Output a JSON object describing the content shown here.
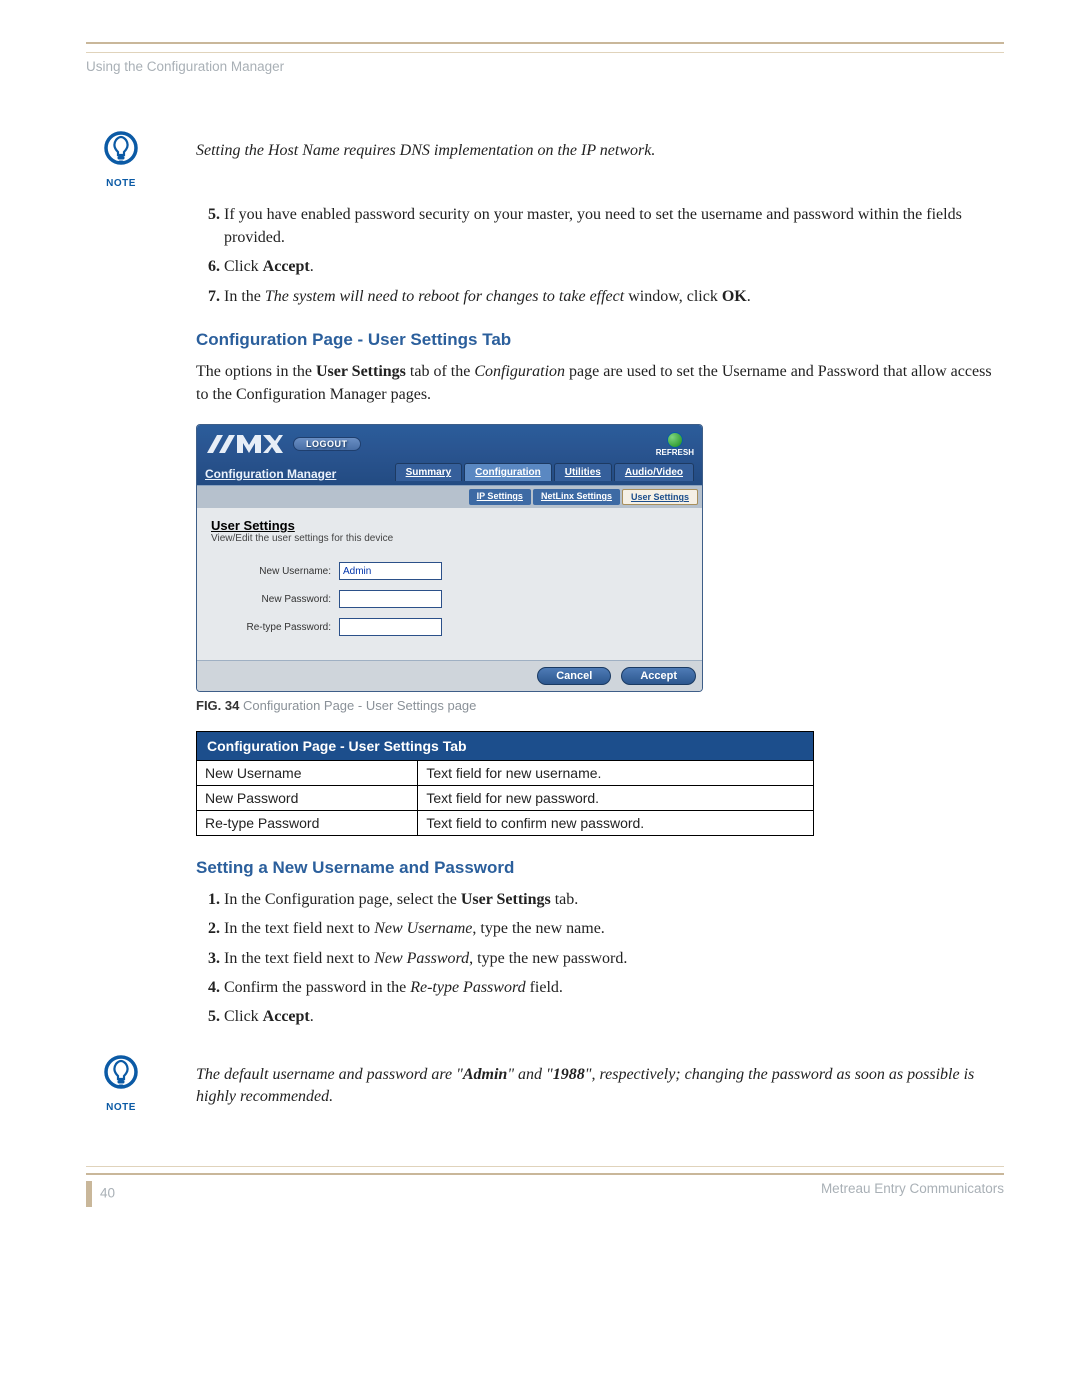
{
  "header": {
    "section": "Using the Configuration Manager"
  },
  "note1": {
    "label": "NOTE",
    "text": "Setting the Host Name requires DNS implementation on the IP network."
  },
  "steps_a": {
    "5": "If you have enabled password security on your master, you need to set the username and password within the fields provided.",
    "6_pre": "Click ",
    "6_bold": "Accept",
    "6_post": ".",
    "7_pre": "In the ",
    "7_it": "The system will need to reboot for changes to take effect",
    "7_mid": " window, click ",
    "7_bold": "OK",
    "7_post": "."
  },
  "h2a": "Configuration Page - User Settings Tab",
  "para1_pre": "The options in the ",
  "para1_b1": "User Settings",
  "para1_mid": " tab of the ",
  "para1_it": "Configuration",
  "para1_after": " page are used to set the Username and Password that allow access to the Configuration Manager pages.",
  "screenshot": {
    "logout": "LOGOUT",
    "refresh": "REFRESH",
    "cm_title": "Configuration Manager",
    "tabs": {
      "summary": "Summary",
      "configuration": "Configuration",
      "utilities": "Utilities",
      "av": "Audio/Video"
    },
    "subtabs": {
      "ip": "IP Settings",
      "netlinx": "NetLinx Settings",
      "user": "User Settings"
    },
    "panel_title": "User Settings",
    "panel_sub": "View/Edit the user settings for this device",
    "lbl_user": "New Username:",
    "lbl_pw": "New Password:",
    "lbl_rpw": "Re-type Password:",
    "val_user": "Admin",
    "btn_cancel": "Cancel",
    "btn_accept": "Accept"
  },
  "fig": {
    "num": "FIG. 34",
    "cap": "  Configuration Page - User Settings page"
  },
  "table": {
    "title": "Configuration Page - User Settings Tab",
    "rows": [
      {
        "k": "New Username",
        "v": "Text field for new username."
      },
      {
        "k": "New Password",
        "v": "Text field for new password."
      },
      {
        "k": "Re-type Password",
        "v": "Text field to confirm new password."
      }
    ]
  },
  "h2b": "Setting a New Username and Password",
  "steps_b": {
    "1_pre": "In the Configuration page, select the ",
    "1_b": "User Settings",
    "1_post": " tab.",
    "2_pre": "In the text field next to ",
    "2_it": "New Username",
    "2_post": ", type the new name.",
    "3_pre": "In the text field next to ",
    "3_it": "New Password",
    "3_post": ", type the new password.",
    "4_pre": "Confirm the password in the ",
    "4_it": "Re-type Password",
    "4_post": " field.",
    "5_pre": "Click ",
    "5_b": "Accept",
    "5_post": "."
  },
  "note2": {
    "label": "NOTE",
    "pre": "The default username and password are \"",
    "b1": "Admin",
    "mid": "\" and \"",
    "b2": "1988",
    "post": "\", respectively; changing the password as soon as possible is highly recommended."
  },
  "footer": {
    "page": "40",
    "title": "Metreau Entry Communicators"
  }
}
